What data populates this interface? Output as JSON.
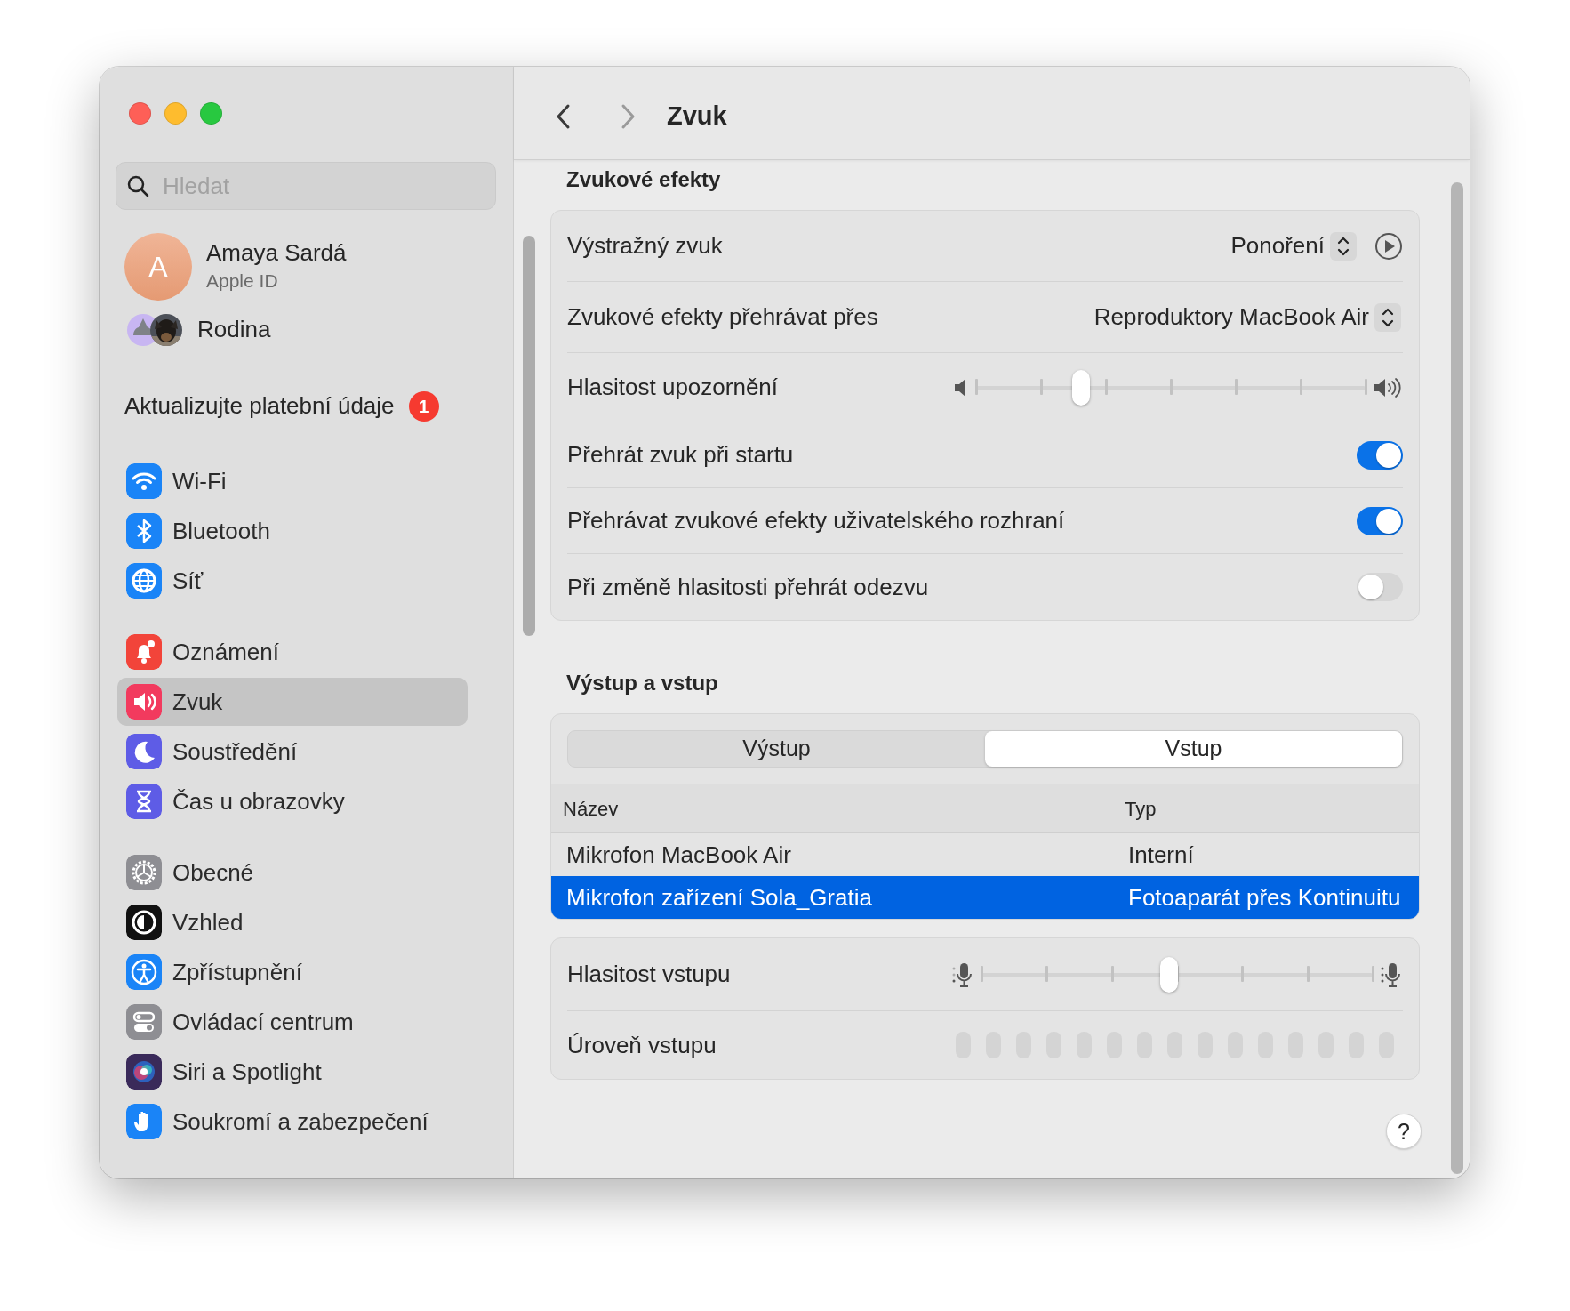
{
  "window": {
    "title": "Zvuk"
  },
  "sidebar": {
    "search": {
      "placeholder": "Hledat"
    },
    "account": {
      "initial": "A",
      "name": "Amaya Sardá",
      "subtitle": "Apple ID"
    },
    "family": {
      "label": "Rodina"
    },
    "notice": {
      "label": "Aktualizujte platební údaje",
      "badge": "1"
    },
    "groups": [
      [
        {
          "kind": "wifi",
          "label": "Wi-Fi",
          "color": "#1a84f7",
          "selected": false
        },
        {
          "kind": "bluetooth",
          "label": "Bluetooth",
          "color": "#1a84f7",
          "selected": false
        },
        {
          "kind": "network",
          "label": "Síť",
          "color": "#1a84f7",
          "selected": false
        }
      ],
      [
        {
          "kind": "notifications",
          "label": "Oznámení",
          "color": "#f2443a",
          "selected": false
        },
        {
          "kind": "sound",
          "label": "Zvuk",
          "color": "#f23a5e",
          "selected": true
        },
        {
          "kind": "focus",
          "label": "Soustředění",
          "color": "#5e5ce6",
          "selected": false
        },
        {
          "kind": "screentime",
          "label": "Čas u obrazovky",
          "color": "#5e5ce6",
          "selected": false
        }
      ],
      [
        {
          "kind": "general",
          "label": "Obecné",
          "color": "#8e8e93",
          "selected": false
        },
        {
          "kind": "appearance",
          "label": "Vzhled",
          "color": "#111111",
          "selected": false
        },
        {
          "kind": "accessibility",
          "label": "Zpřístupnění",
          "color": "#1a84f7",
          "selected": false
        },
        {
          "kind": "controlcenter",
          "label": "Ovládací centrum",
          "color": "#8e8e93",
          "selected": false
        },
        {
          "kind": "siri",
          "label": "Siri a Spotlight",
          "color": "#3a2a5a",
          "selected": false
        },
        {
          "kind": "privacy",
          "label": "Soukromí a zabezpečení",
          "color": "#1a84f7",
          "selected": false
        }
      ]
    ]
  },
  "sound_effects": {
    "title": "Zvukové efekty",
    "rows": [
      {
        "kind": "popup",
        "label": "Výstražný zvuk",
        "value": "Ponoření",
        "play_button": true
      },
      {
        "kind": "popup",
        "label": "Zvukové efekty přehrávat přes",
        "value": "Reproduktory MacBook Air"
      },
      {
        "kind": "slider",
        "label": "Hlasitost upozornění",
        "level": 0.27
      },
      {
        "kind": "toggle",
        "label": "Přehrát zvuk při startu",
        "on": true
      },
      {
        "kind": "toggle",
        "label": "Přehrávat zvukové efekty uživatelského rozhraní",
        "on": true
      },
      {
        "kind": "toggle",
        "label": "Při změně hlasitosti přehrát odezvu",
        "on": false
      }
    ]
  },
  "output_input": {
    "title": "Výstup a vstup",
    "tabs": [
      {
        "label": "Výstup",
        "selected": false
      },
      {
        "label": "Vstup",
        "selected": true
      }
    ],
    "table": {
      "columns": [
        "Název",
        "Typ"
      ],
      "rows": [
        {
          "cells": [
            "Mikrofon MacBook Air",
            "Interní"
          ],
          "selected": false
        },
        {
          "cells": [
            "Mikrofon zařízení Sola_Gratia",
            "Fotoaparát přes Kontinuitu"
          ],
          "selected": true
        }
      ]
    },
    "input_volume": {
      "label": "Hlasitost vstupu",
      "level": 0.48
    },
    "input_level": {
      "label": "Úroveň vstupu"
    }
  },
  "help": "?"
}
